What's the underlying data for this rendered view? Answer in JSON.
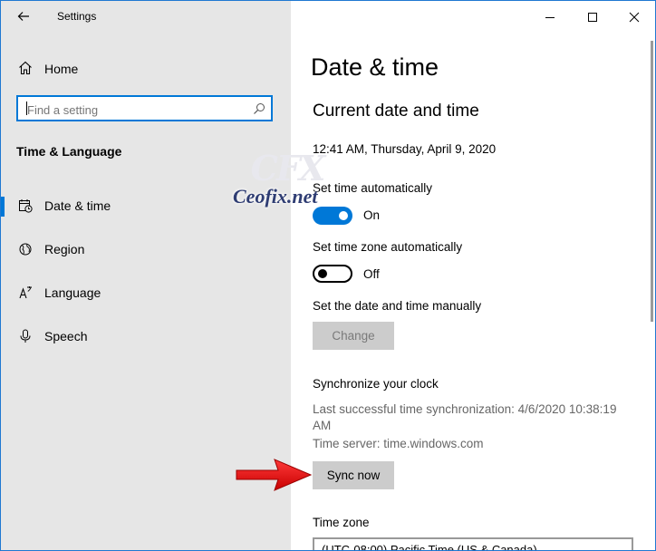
{
  "window": {
    "title": "Settings"
  },
  "sidebar": {
    "home_label": "Home",
    "search": {
      "placeholder": "Find a setting",
      "value": ""
    },
    "section_header": "Time & Language",
    "items": [
      {
        "label": "Date & time",
        "icon": "calendar-clock-icon",
        "active": true
      },
      {
        "label": "Region",
        "icon": "globe-icon",
        "active": false
      },
      {
        "label": "Language",
        "icon": "language-icon",
        "active": false
      },
      {
        "label": "Speech",
        "icon": "microphone-icon",
        "active": false
      }
    ]
  },
  "main": {
    "page_title": "Date & time",
    "current_heading": "Current date and time",
    "current_value": "12:41 AM, Thursday, April 9, 2020",
    "set_time_auto": {
      "label": "Set time automatically",
      "state": "On"
    },
    "set_tz_auto": {
      "label": "Set time zone automatically",
      "state": "Off"
    },
    "manual": {
      "label": "Set the date and time manually",
      "button": "Change"
    },
    "sync": {
      "heading": "Synchronize your clock",
      "last_line1": "Last successful time synchronization: 4/6/2020 10:38:19",
      "last_line2": "AM",
      "server": "Time server: time.windows.com",
      "button": "Sync now"
    },
    "timezone": {
      "label": "Time zone",
      "value": "(UTC-08:00) Pacific Time (US & Canada)"
    }
  },
  "watermark": {
    "text": "Ceofix.net",
    "logo": "CFX"
  },
  "colors": {
    "accent": "#0078d7",
    "sidebar_bg": "#e6e6e6",
    "arrow": "#e81010"
  }
}
